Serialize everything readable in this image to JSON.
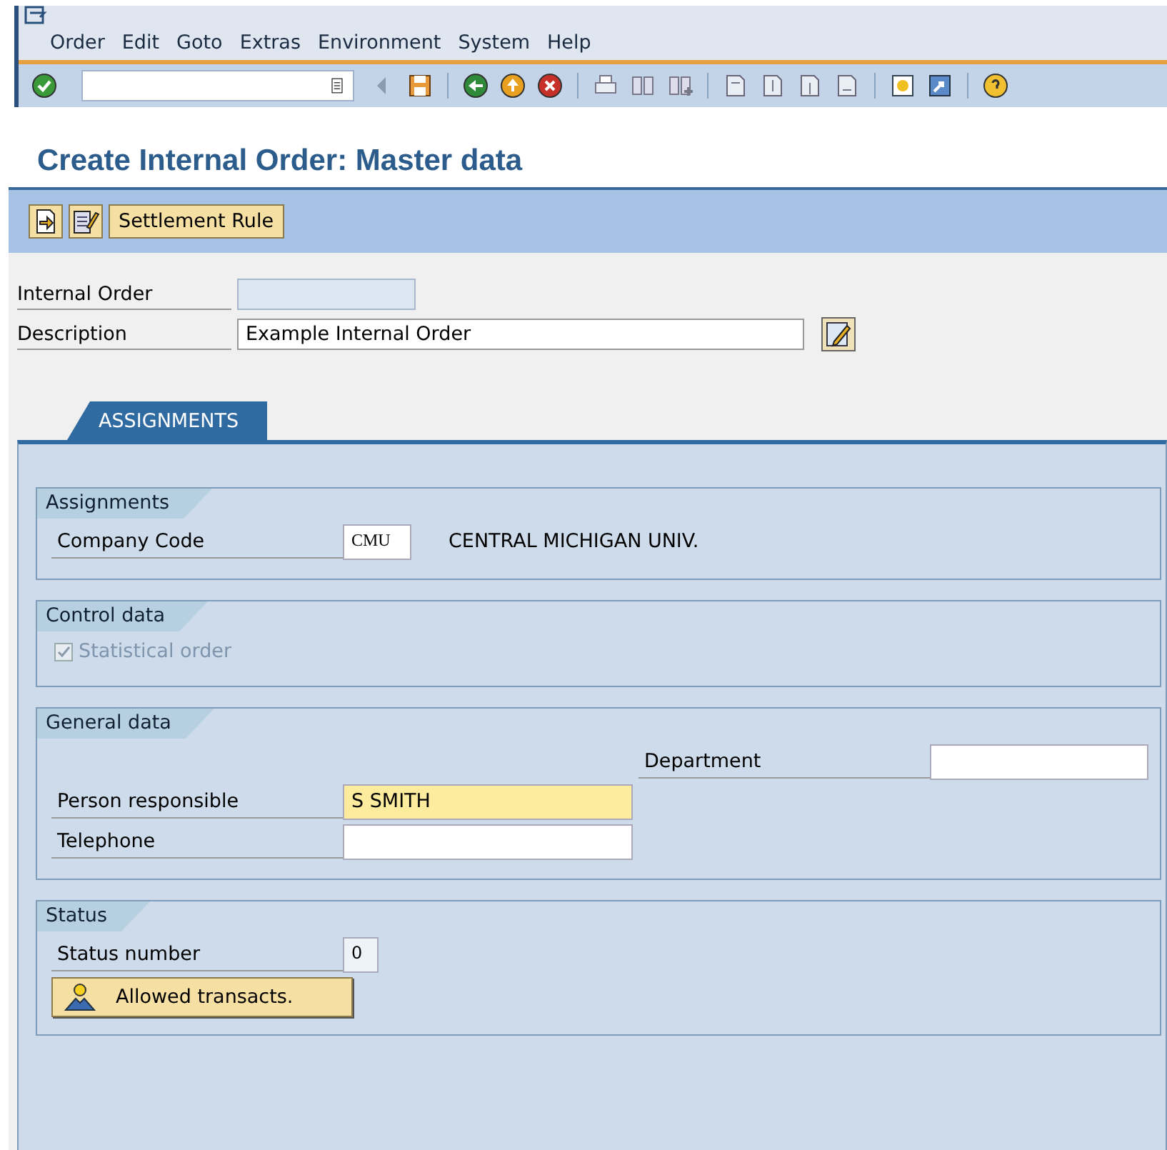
{
  "menu": [
    {
      "label": "Order"
    },
    {
      "label": "Edit"
    },
    {
      "label": "Goto"
    },
    {
      "label": "Extras"
    },
    {
      "label": "Environment"
    },
    {
      "label": "System"
    },
    {
      "label": "Help"
    }
  ],
  "title": "Create Internal Order: Master data",
  "app_toolbar": {
    "button": "Settlement Rule"
  },
  "header_fields": [
    {
      "label": "Internal Order",
      "kind": "readonly"
    },
    {
      "label": "Description",
      "value": "Example Internal Order",
      "kind": "input"
    }
  ],
  "tabs": [
    {
      "label": "ASSIGNMENTS",
      "selected": true
    }
  ],
  "groups": [
    {
      "title": "Assignments",
      "rows": [
        {
          "kind": "code_field",
          "label": "Company Code",
          "value": "CMU",
          "highlighted": false,
          "description": "CENTRAL MICHIGAN UNIV."
        }
      ]
    },
    {
      "title": "Control data",
      "rows": [
        {
          "kind": "checkbox",
          "label": "Statistical order",
          "checked": true,
          "disabled": true
        }
      ]
    },
    {
      "title": "General data",
      "rows": [
        {
          "kind": "field_right",
          "label": "Department",
          "highlighted": false
        },
        {
          "kind": "field",
          "label": "Person responsible",
          "value": "S SMITH",
          "highlighted": true
        },
        {
          "kind": "field",
          "label": "Telephone",
          "highlighted": false
        }
      ]
    },
    {
      "title": "Status",
      "rows": [
        {
          "kind": "number_field",
          "label": "Status number",
          "value": "0",
          "highlighted": false
        },
        {
          "kind": "button",
          "label": "Allowed transacts."
        }
      ]
    }
  ]
}
